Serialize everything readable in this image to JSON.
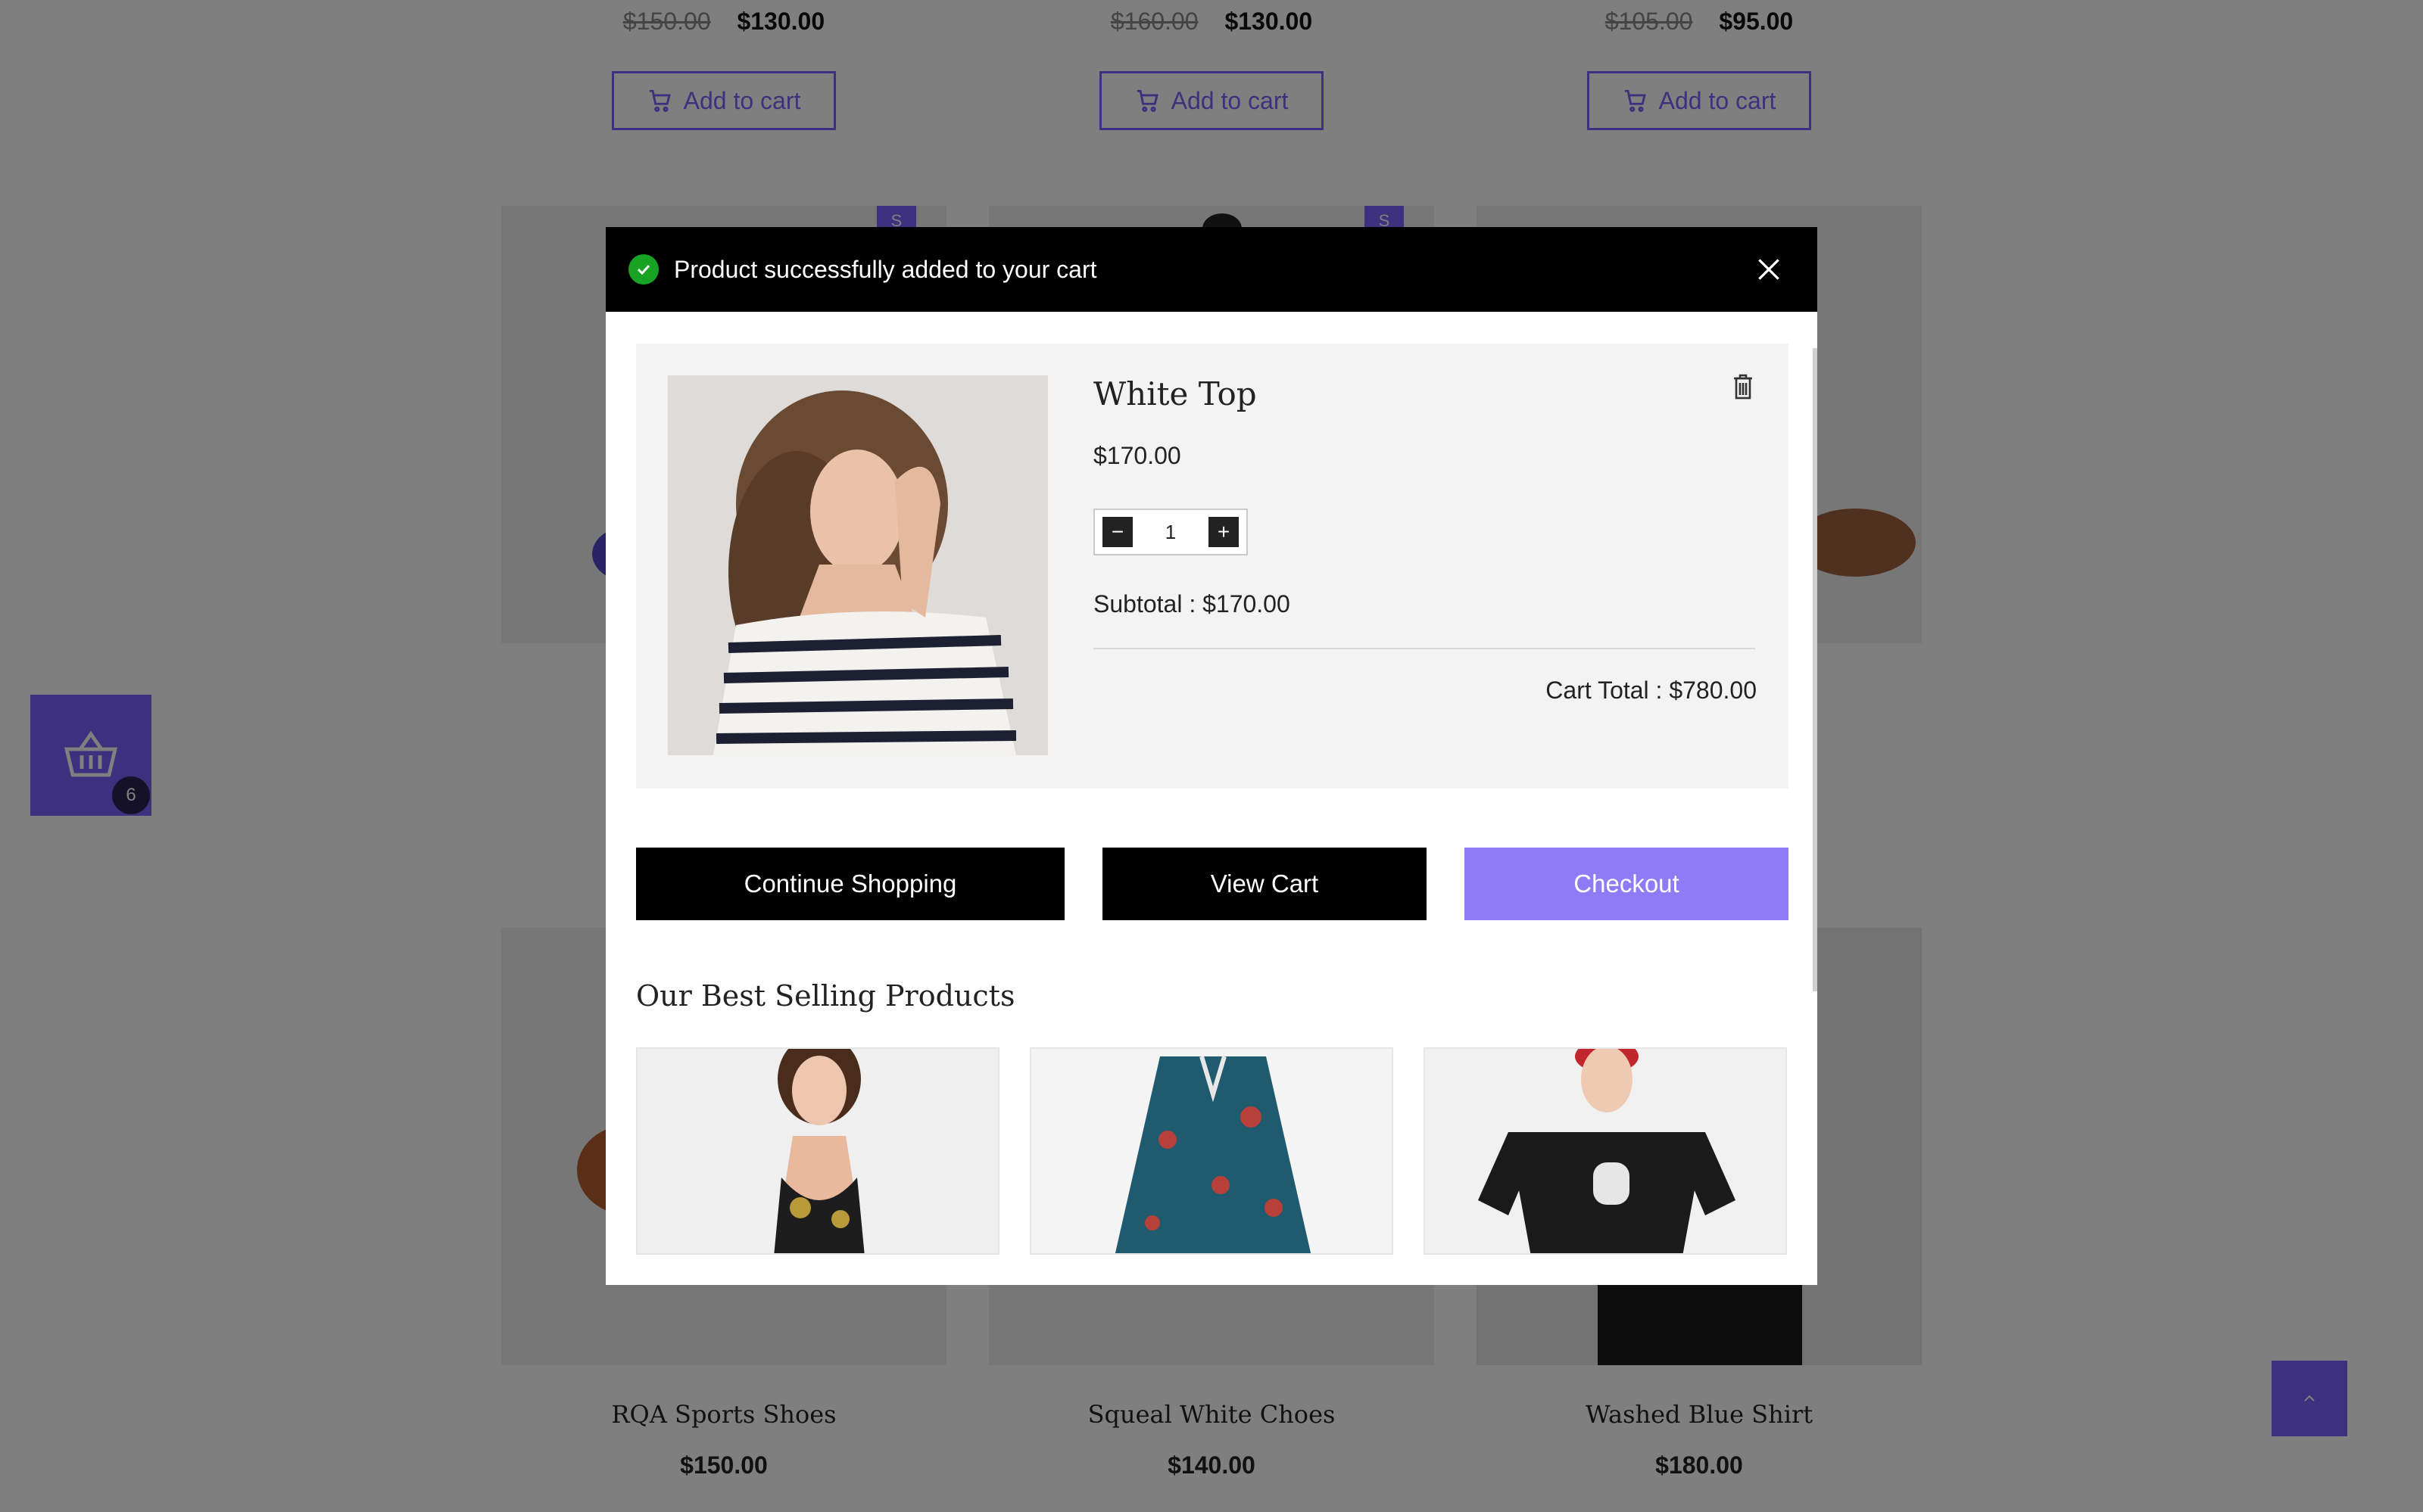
{
  "background": {
    "top_products": [
      {
        "old_price": "$150.00",
        "price": "$130.00",
        "add_to_cart": "Add to cart"
      },
      {
        "old_price": "$160.00",
        "price": "$130.00",
        "add_to_cart": "Add to cart"
      },
      {
        "old_price": "$105.00",
        "price": "$95.00",
        "add_to_cart": "Add to cart"
      }
    ],
    "sale_tag": "S",
    "bottom_products": [
      {
        "name": "RQA Sports Shoes",
        "price": "$150.00"
      },
      {
        "name": "Squeal White Choes",
        "price": "$140.00"
      },
      {
        "name": "Washed Blue Shirt",
        "price": "$180.00"
      }
    ],
    "floating_cart_count": "6"
  },
  "modal": {
    "title": "Product successfully added to your cart",
    "item": {
      "name": "White Top",
      "price": "$170.00",
      "quantity": "1",
      "qty_minus": "−",
      "qty_plus": "+",
      "subtotal": "Subtotal : $170.00"
    },
    "cart_total": "Cart Total : $780.00",
    "buttons": {
      "continue": "Continue Shopping",
      "view_cart": "View Cart",
      "checkout": "Checkout"
    },
    "best_selling_title": "Our Best Selling Products"
  },
  "colors": {
    "accent": "#7b61ff",
    "checkout": "#8f7bf5",
    "success": "#19a324",
    "header": "#000000"
  },
  "icons": [
    "cart-icon",
    "basket-icon",
    "check-icon",
    "close-icon",
    "trash-icon",
    "arrow-up-icon"
  ]
}
